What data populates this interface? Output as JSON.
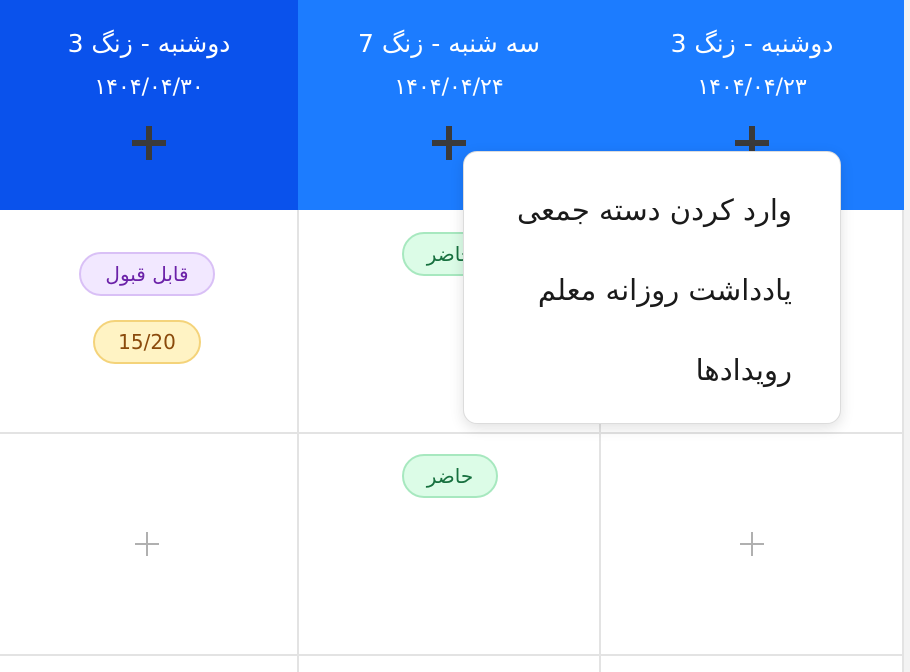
{
  "columns": [
    {
      "title": "دوشنبه - زنگ 3",
      "date": "۱۴۰۴/۰۴/۳۰",
      "accent": "#0a52ec"
    },
    {
      "title": "سه شنبه - زنگ 7",
      "date": "۱۴۰۴/۰۴/۲۴",
      "accent": "#1c7cff"
    },
    {
      "title": "دوشنبه - زنگ 3",
      "date": "۱۴۰۴/۰۴/۲۳",
      "accent": "#1c7cff"
    }
  ],
  "rows": [
    {
      "cells": [
        {
          "grade_badge": "قابل قبول",
          "score_badge": "15/20"
        },
        {
          "attendance": "حاضر"
        },
        {
          "attendance": ""
        }
      ]
    },
    {
      "cells": [
        {
          "add_icon": "plus-icon"
        },
        {
          "attendance": "حاضر"
        },
        {
          "add_icon": "plus-icon"
        }
      ]
    }
  ],
  "context_menu": {
    "items": [
      "وارد کردن دسته جمعی",
      "یادداشت روزانه معلم",
      "رویدادها"
    ]
  },
  "icons": {
    "header_add": "plus-icon",
    "cell_add": "plus-icon"
  }
}
